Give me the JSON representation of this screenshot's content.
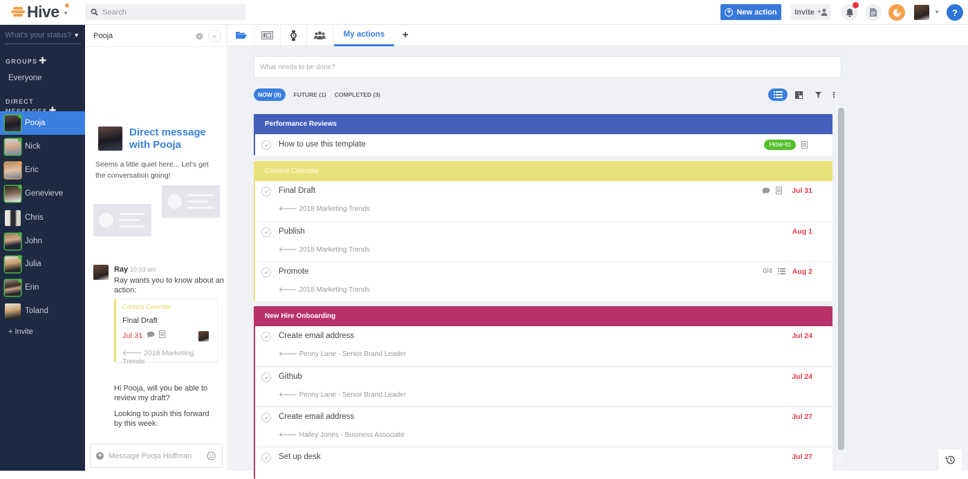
{
  "app": {
    "name": "Hive"
  },
  "topbar": {
    "search_placeholder": "Search",
    "new_action_label": "New action",
    "invite_label": "Invite",
    "icons": [
      "bell-icon",
      "document-icon",
      "pie-chart-icon",
      "user-avatar",
      "help-icon"
    ],
    "help_label": "?",
    "colors": {
      "primary": "#3778db",
      "accent": "#f5a04c",
      "notification": "#f03240"
    }
  },
  "sidebar": {
    "status_placeholder": "What's your status?",
    "groups_title": "GROUPS",
    "groups": [
      {
        "label": "Everyone"
      }
    ],
    "dm_title": "DIRECT MESSAGES",
    "contacts": [
      {
        "name": "Pooja",
        "presence": "online",
        "active": true
      },
      {
        "name": "Nick",
        "presence": "online"
      },
      {
        "name": "Eric",
        "presence": "away"
      },
      {
        "name": "Genevieve",
        "presence": "online"
      },
      {
        "name": "Chris",
        "presence": "offline"
      },
      {
        "name": "John",
        "presence": "online"
      },
      {
        "name": "Julia",
        "presence": "online"
      },
      {
        "name": "Erin",
        "presence": "online"
      },
      {
        "name": "Toland",
        "presence": "offline"
      }
    ],
    "invite_label": "+ Invite"
  },
  "chat": {
    "header_name": "Pooja",
    "collapse_label": "«",
    "intro_title": "Direct message with Pooja",
    "intro_text": "Seems a little quiet here... Let's get the conversation going!",
    "message": {
      "sender": "Ray",
      "time": "10:03 am",
      "text": "Ray wants you to know about an action:",
      "card": {
        "project": "Content Calendar",
        "title": "Final Draft",
        "date": "Jul 31",
        "parent": "2018 Marketing Trends"
      }
    },
    "replies": [
      "Hi Pooja, will you be able to review my draft?",
      "Looking to push this forward by this week."
    ],
    "composer_placeholder": "Message Pooja Hoffman"
  },
  "main": {
    "tabs": [
      {
        "icon": "folder-icon"
      },
      {
        "icon": "kanban-card-icon"
      },
      {
        "icon": "stopwatch-icon"
      },
      {
        "icon": "team-icon"
      },
      {
        "label": "My actions",
        "active": true
      }
    ],
    "add_tab_label": "+",
    "todo_placeholder": "What needs to be done?",
    "filters": [
      {
        "label": "NOW (8)",
        "active": true
      },
      {
        "label": "FUTURE (1)"
      },
      {
        "label": "COMPLETED (3)"
      }
    ],
    "sections": [
      {
        "title": "Performance Reviews",
        "color": "#4360bd",
        "rows": [
          {
            "title": "How to use this template",
            "tag": "How-to",
            "has_note": true
          }
        ]
      },
      {
        "title": "Content Calendar",
        "color": "#e8e27a",
        "rows": [
          {
            "title": "Final Draft",
            "parent": "2018 Marketing Trends",
            "date": "Jul 31",
            "has_comment": true,
            "has_note": true
          },
          {
            "title": "Publish",
            "parent": "2018 Marketing Trends",
            "date": "Aug 1"
          },
          {
            "title": "Promote",
            "parent": "2018 Marketing Trends",
            "date": "Aug 2",
            "subtasks": "0/4"
          }
        ]
      },
      {
        "title": "New Hire Onboarding",
        "color": "#b9336a",
        "rows": [
          {
            "title": "Create email address",
            "parent": "Penny Lane - Senior Brand Leader",
            "date": "Jul 24"
          },
          {
            "title": "Github",
            "parent": "Penny Lane - Senior Brand Leader",
            "date": "Jul 24"
          },
          {
            "title": "Create email address",
            "parent": "Hailey Jones - Business Associate",
            "date": "Jul 27"
          },
          {
            "title": "Set up desk",
            "date": "Jul 27"
          }
        ]
      }
    ]
  }
}
